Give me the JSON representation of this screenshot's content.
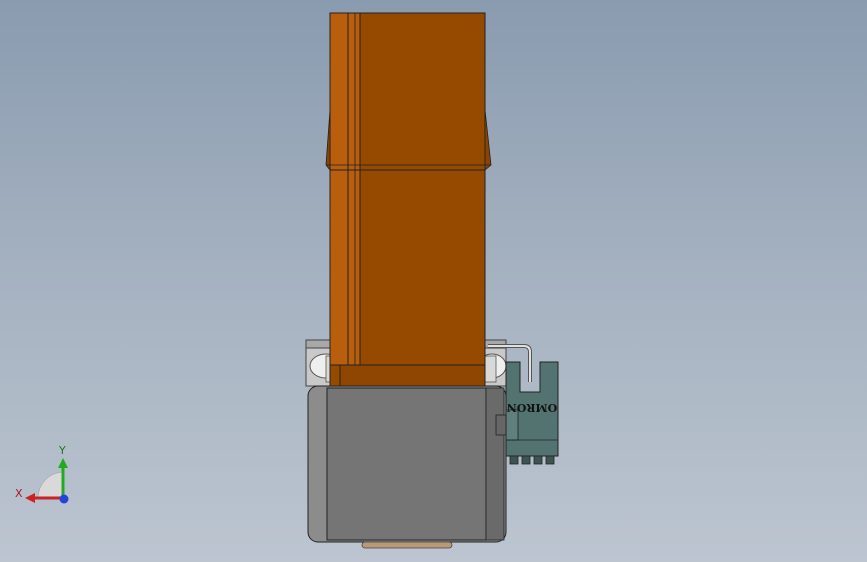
{
  "scene": {
    "sensor_brand": "OMRON",
    "colors": {
      "actuator_body": "#964a00",
      "actuator_edge": "#b85e0c",
      "motor_housing": "#757575",
      "motor_frame": "#8c8c8c",
      "sensor_body": "#52736f",
      "background_top": "#8a9bb0",
      "background_bottom": "#bcc5d0"
    }
  },
  "triad": {
    "x_label": "X",
    "y_label": "Y",
    "x_color": "#cc2222",
    "y_color": "#22aa22",
    "z_color": "#2244dd"
  }
}
